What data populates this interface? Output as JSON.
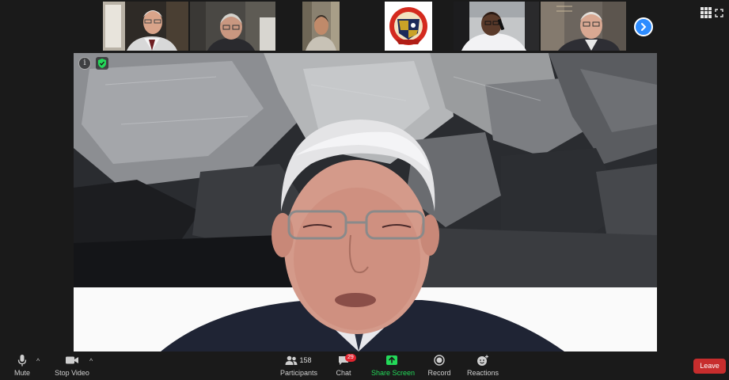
{
  "participants_strip": {
    "thumbnails": [
      {
        "name": "participant-1"
      },
      {
        "name": "participant-2"
      },
      {
        "name": "participant-3"
      },
      {
        "name": "participant-4-logo"
      },
      {
        "name": "participant-5"
      },
      {
        "name": "participant-6"
      }
    ],
    "next_icon": "chevron-right-icon"
  },
  "main_video": {
    "info_icon": "i"
  },
  "toolbar": {
    "mute_label": "Mute",
    "stop_video_label": "Stop Video",
    "participants_label": "Participants",
    "participants_count": "158",
    "chat_label": "Chat",
    "chat_badge": "29",
    "share_screen_label": "Share Screen",
    "record_label": "Record",
    "reactions_label": "Reactions",
    "leave_label": "Leave",
    "caret": "^"
  },
  "colors": {
    "accent": "#2d8cff",
    "share_green": "#23d959",
    "leave_red": "#c72d2d",
    "background": "#1a1a1a"
  }
}
